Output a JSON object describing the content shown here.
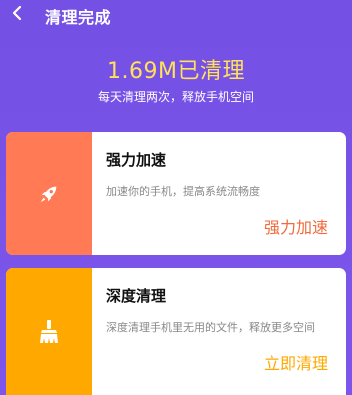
{
  "header": {
    "title": "清理完成",
    "back_icon": "back-arrow-icon"
  },
  "summary": {
    "cleaned_amount": "1.69M已清理",
    "subtitle": "每天清理两次，释放手机空间"
  },
  "cards": [
    {
      "title": "强力加速",
      "description": "加速你的手机，提高系统流畅度",
      "action": "强力加速",
      "icon": "rocket-icon",
      "accent": "#ff7a55"
    },
    {
      "title": "深度清理",
      "description": "深度清理手机里无用的文件，释放更多空间",
      "action": "立即清理",
      "icon": "broom-icon",
      "accent": "#ffa800"
    }
  ],
  "colors": {
    "background": "#7a52e8",
    "highlight": "#ffe15a"
  }
}
